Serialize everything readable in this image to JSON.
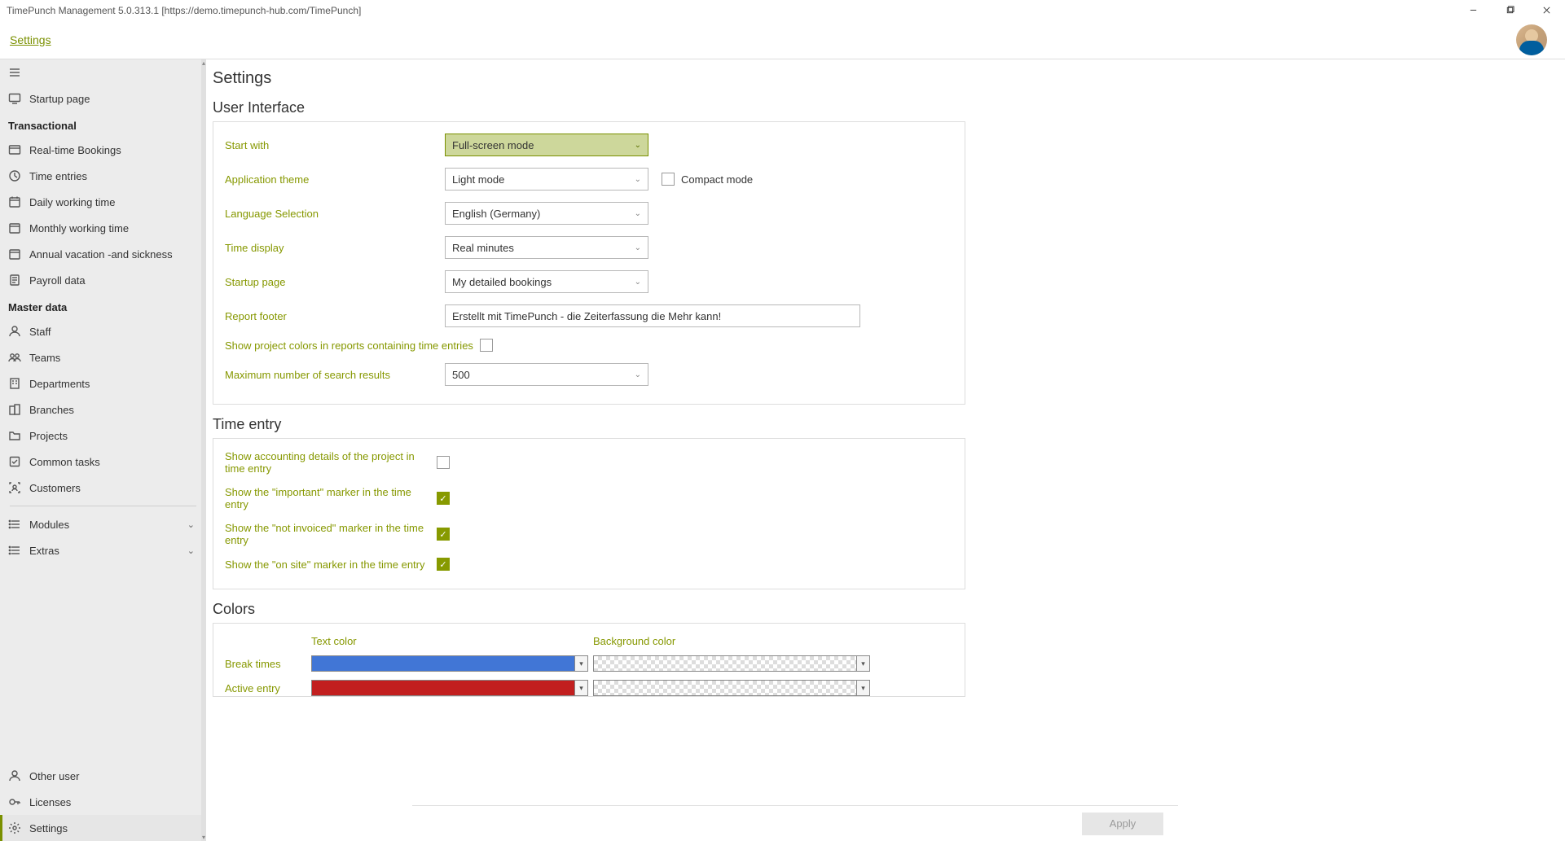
{
  "window_title": "TimePunch Management 5.0.313.1  [https://demo.timepunch-hub.com/TimePunch]",
  "breadcrumb": "Settings",
  "page_title": "Settings",
  "sidebar": {
    "startup_page": "Startup page",
    "heading_transactional": "Transactional",
    "real_time_bookings": "Real-time Bookings",
    "time_entries": "Time entries",
    "daily_working_time": "Daily working time",
    "monthly_working_time": "Monthly working time",
    "annual_vacation": "Annual vacation -and sickness",
    "payroll_data": "Payroll data",
    "heading_masterdata": "Master data",
    "staff": "Staff",
    "teams": "Teams",
    "departments": "Departments",
    "branches": "Branches",
    "projects": "Projects",
    "common_tasks": "Common tasks",
    "customers": "Customers",
    "modules": "Modules",
    "extras": "Extras",
    "other_user": "Other user",
    "licenses": "Licenses",
    "settings": "Settings"
  },
  "sections": {
    "ui": {
      "title": "User Interface",
      "start_with_label": "Start with",
      "start_with_value": "Full-screen mode",
      "app_theme_label": "Application theme",
      "app_theme_value": "Light mode",
      "compact_mode_label": "Compact mode",
      "language_label": "Language Selection",
      "language_value": "English (Germany)",
      "time_display_label": "Time display",
      "time_display_value": "Real minutes",
      "startup_page_label": "Startup page",
      "startup_page_value": "My detailed bookings",
      "report_footer_label": "Report footer",
      "report_footer_value": "Erstellt mit TimePunch - die Zeiterfassung die Mehr kann!",
      "show_project_colors_label": "Show project colors in reports containing time entries",
      "max_search_label": "Maximum number of search results",
      "max_search_value": "500"
    },
    "time_entry": {
      "title": "Time entry",
      "show_accounting_label": "Show accounting details of the project in time entry",
      "show_important_label": "Show the \"important\" marker in the time entry",
      "show_not_invoiced_label": "Show the \"not invoiced\" marker in the time entry",
      "show_on_site_label": "Show the \"on site\" marker in the time entry"
    },
    "colors": {
      "title": "Colors",
      "text_color_header": "Text color",
      "bg_color_header": "Background color",
      "break_times_label": "Break times",
      "break_times_text_color": "#4176d6",
      "active_entry_label": "Active entry",
      "active_entry_text_color": "#c21f1f"
    }
  },
  "apply_label": "Apply"
}
